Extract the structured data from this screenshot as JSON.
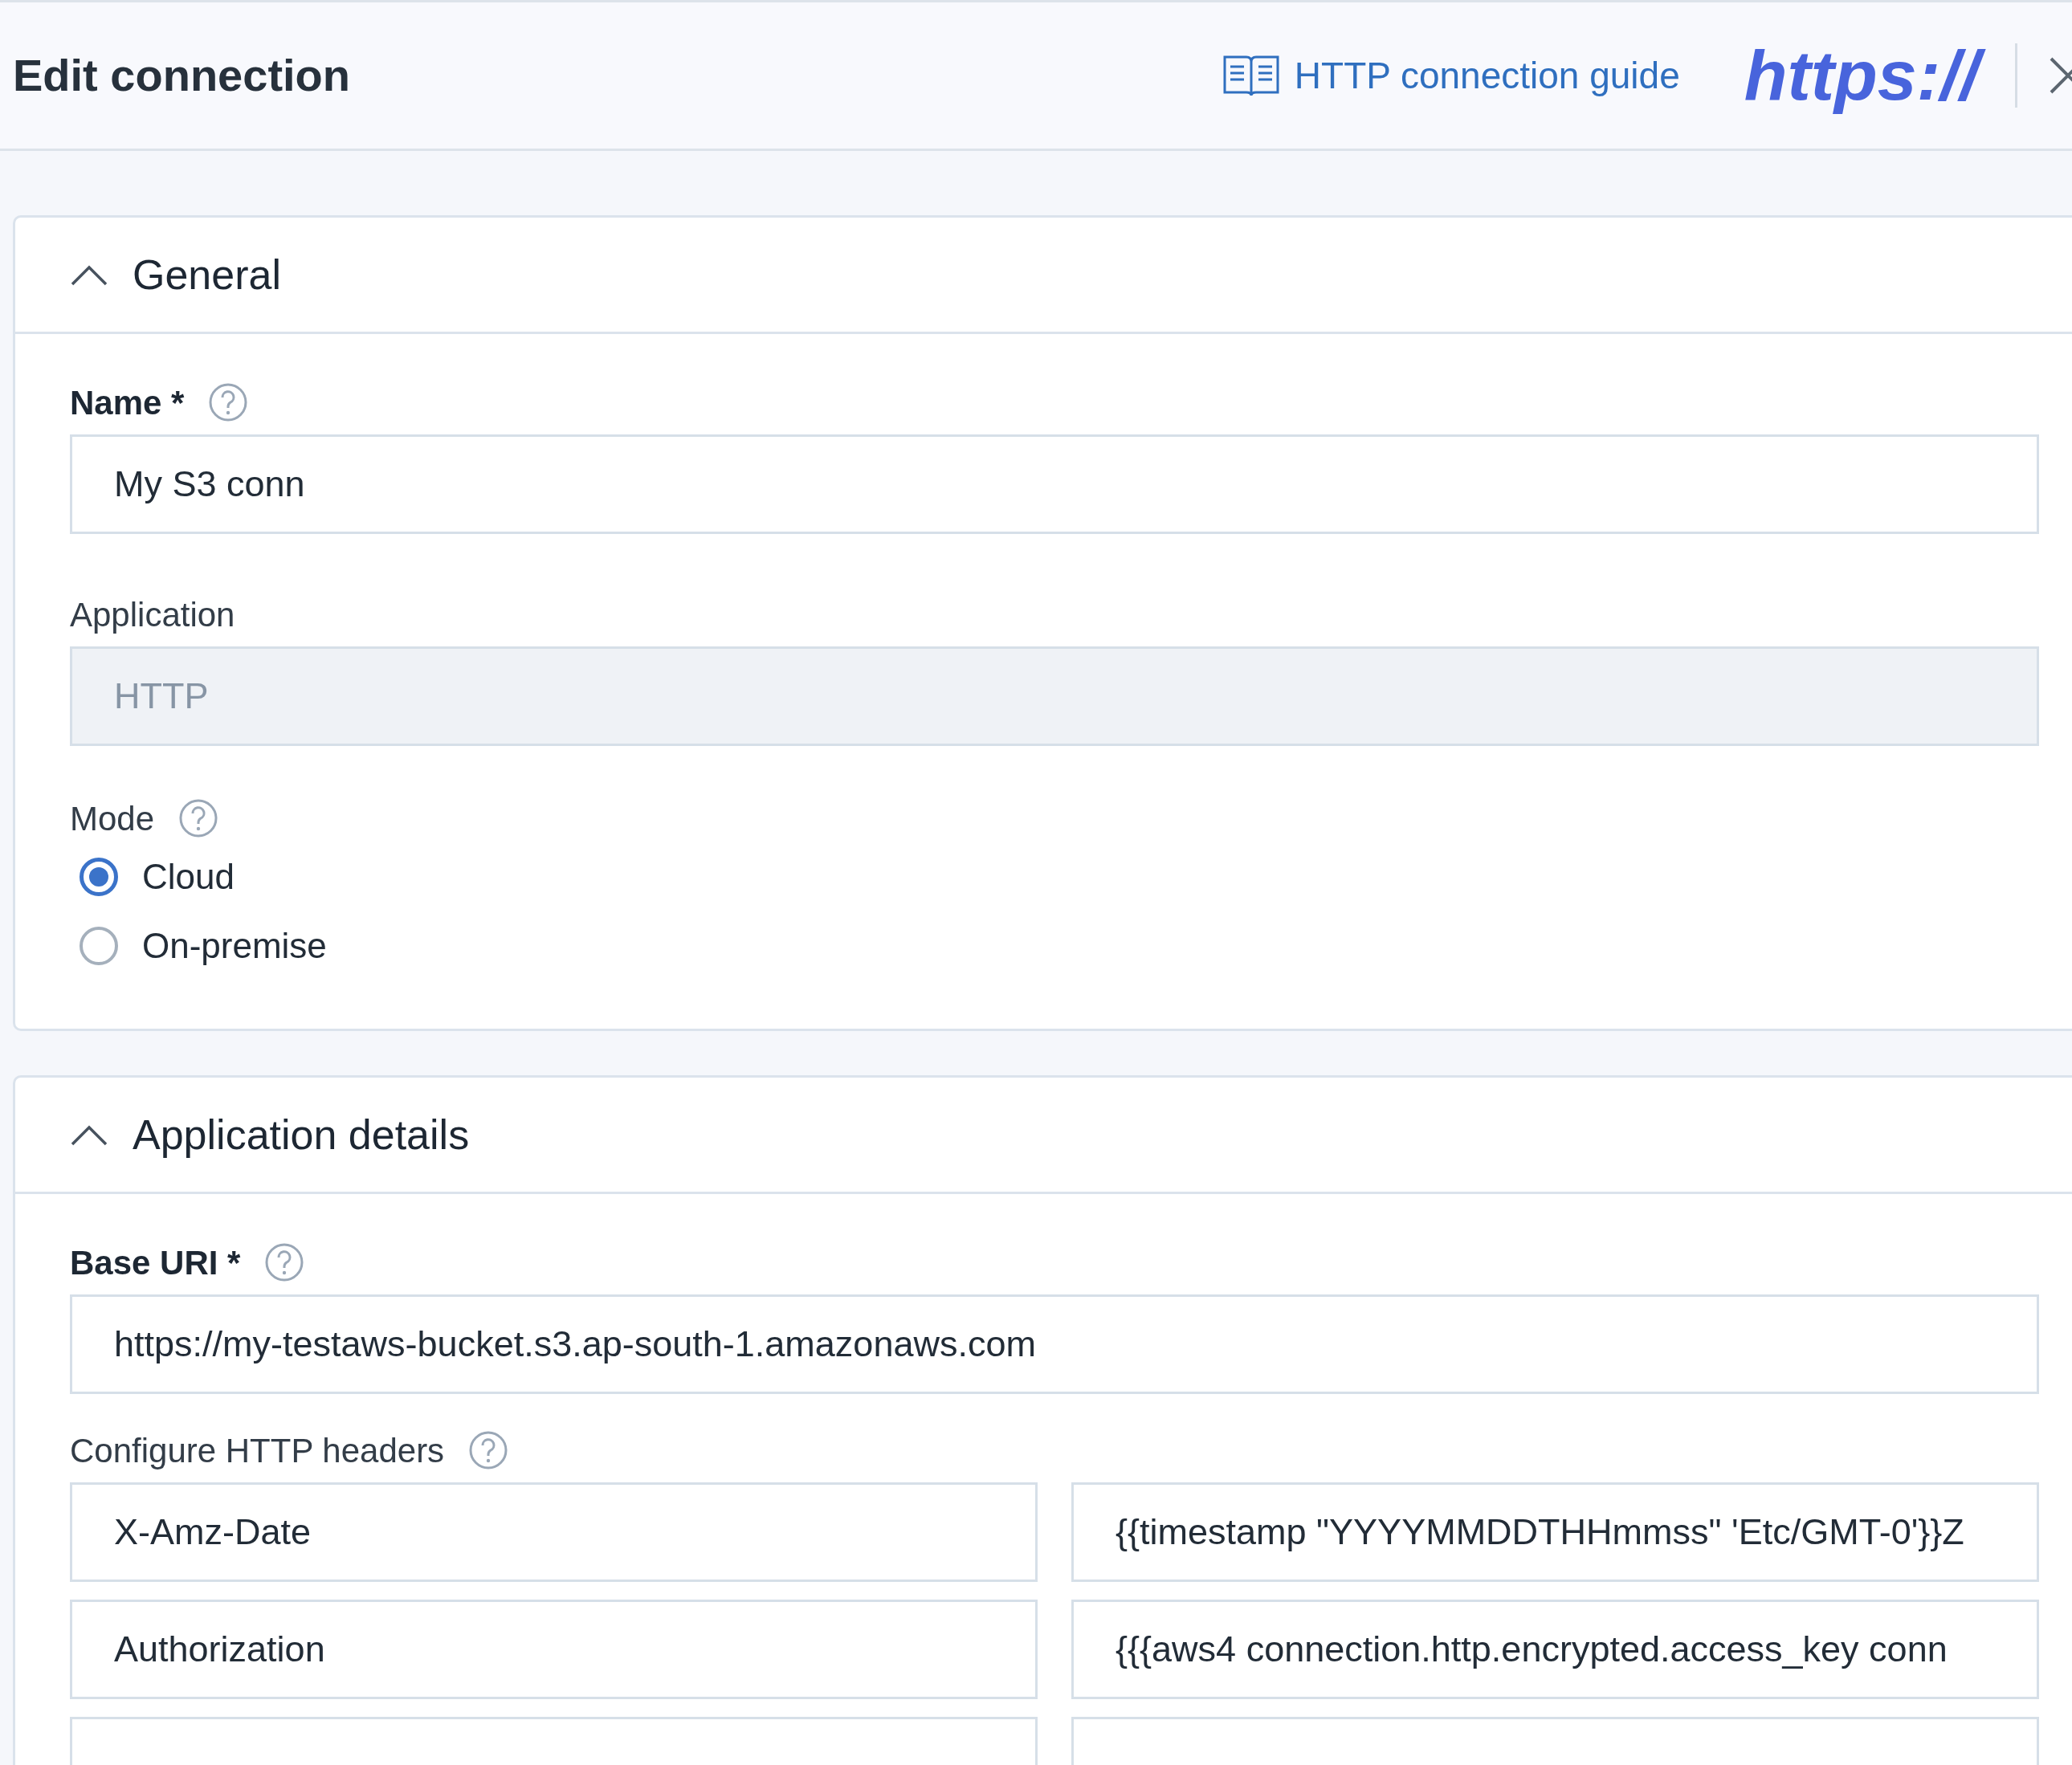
{
  "header": {
    "title": "Edit connection",
    "guide_link": "HTTP connection guide",
    "logo_text": "https://"
  },
  "sections": [
    {
      "title": "General",
      "expanded": true,
      "fields": [
        {
          "kind": "text",
          "label": "Name *",
          "required": true,
          "help": true,
          "value": "My S3 conn",
          "disabled": false
        },
        {
          "kind": "text",
          "label": "Application",
          "required": false,
          "help": false,
          "value": "HTTP",
          "disabled": true
        },
        {
          "kind": "radio",
          "label": "Mode",
          "required": false,
          "help": true,
          "options": [
            {
              "label": "Cloud",
              "selected": true
            },
            {
              "label": "On-premise",
              "selected": false
            }
          ]
        }
      ]
    },
    {
      "title": "Application details",
      "expanded": true,
      "fields": [
        {
          "kind": "text",
          "label": "Base URI *",
          "required": true,
          "help": true,
          "value": "https://my-testaws-bucket.s3.ap-south-1.amazonaws.com",
          "disabled": false
        },
        {
          "kind": "pairs",
          "label": "Configure HTTP headers",
          "required": false,
          "help": true,
          "rows": [
            {
              "kind": "pair",
              "key": "X-Amz-Date",
              "value": "{{timestamp \"YYYYMMDDTHHmmss\" 'Etc/GMT-0'}}Z"
            },
            {
              "kind": "pair",
              "key": "Authorization",
              "value": "{{{aws4 connection.http.encrypted.access_key conn"
            },
            {
              "kind": "blank"
            }
          ]
        }
      ]
    }
  ]
}
